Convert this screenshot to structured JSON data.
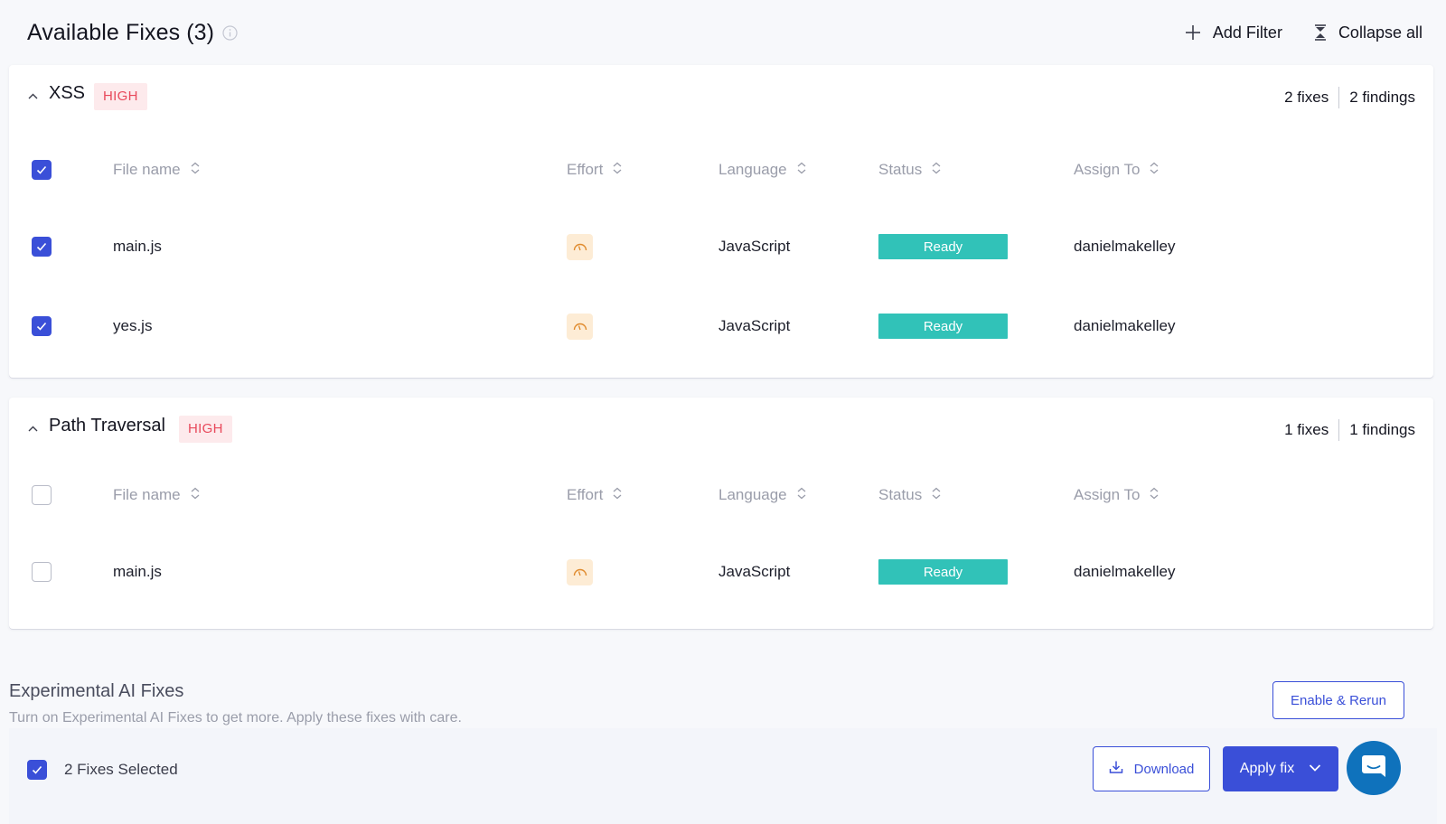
{
  "header": {
    "title": "Available Fixes (3)",
    "add_filter_label": "Add Filter",
    "collapse_all_label": "Collapse all"
  },
  "columns": {
    "file_name": "File name",
    "effort": "Effort",
    "language": "Language",
    "status": "Status",
    "assign_to": "Assign To"
  },
  "groups": [
    {
      "name": "XSS",
      "severity": "HIGH",
      "fixes": "2 fixes",
      "findings": "2 findings",
      "header_checked": true,
      "rows": [
        {
          "file": "main.js",
          "language": "JavaScript",
          "status": "Ready",
          "assignee": "danielmakelley",
          "checked": true
        },
        {
          "file": "yes.js",
          "language": "JavaScript",
          "status": "Ready",
          "assignee": "danielmakelley",
          "checked": true
        }
      ]
    },
    {
      "name": "Path Traversal",
      "severity": "HIGH",
      "fixes": "1 fixes",
      "findings": "1 findings",
      "header_checked": false,
      "rows": [
        {
          "file": "main.js",
          "language": "JavaScript",
          "status": "Ready",
          "assignee": "danielmakelley",
          "checked": false
        }
      ]
    }
  ],
  "experimental": {
    "title": "Experimental AI Fixes",
    "description": "Turn on Experimental AI Fixes to get more. Apply these fixes with care.",
    "button_label": "Enable & Rerun"
  },
  "footer": {
    "selected_label": "2 Fixes Selected",
    "download_label": "Download",
    "apply_label": "Apply fix"
  },
  "icons": {
    "info": "info-icon",
    "add": "plus-icon",
    "collapse": "collapse-icon",
    "chevron": "chevron-up-icon",
    "sort": "sort-icon",
    "effort": "gauge-icon",
    "download": "download-icon",
    "apply_dropdown": "chevron-down-icon",
    "chat": "chat-icon"
  },
  "colors": {
    "accent": "#3a4fd8",
    "severity_high": "#e8495b",
    "status_ready": "#31c2b8",
    "effort_bg": "#fdecd5",
    "chat": "#0f72bc"
  }
}
